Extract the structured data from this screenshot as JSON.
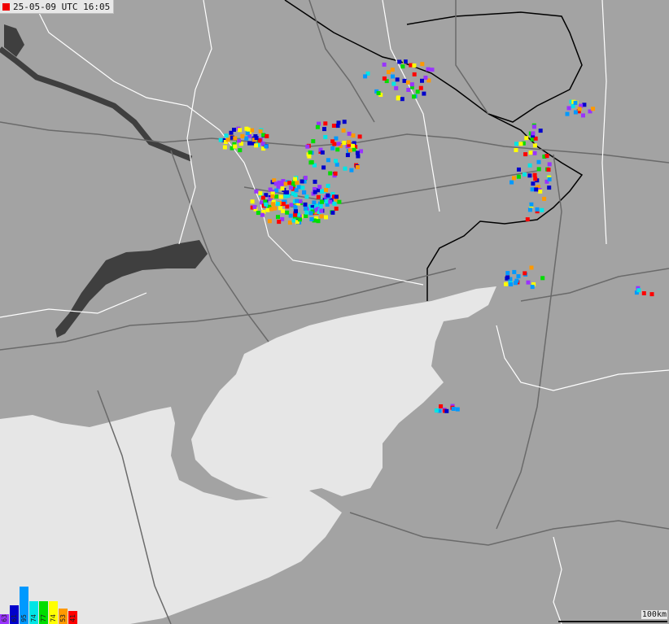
{
  "header": {
    "timestamp": "25-05-09 UTC 16:05",
    "marker_color": "#f00000"
  },
  "legend": {
    "items": [
      {
        "label": "63",
        "color": "#9933ff",
        "level": 0.25
      },
      {
        "label": "61",
        "color": "#0000cc",
        "level": 0.5
      },
      {
        "label": "95",
        "color": "#0099ff",
        "level": 1.0
      },
      {
        "label": "74",
        "color": "#00e5e5",
        "level": 0.6
      },
      {
        "label": "77",
        "color": "#00dd00",
        "level": 0.6
      },
      {
        "label": "74",
        "color": "#ffff00",
        "level": 0.6
      },
      {
        "label": "53",
        "color": "#ff9900",
        "level": 0.42
      },
      {
        "label": "41",
        "color": "#ff0000",
        "level": 0.35
      }
    ]
  },
  "scale": {
    "label": "100km"
  },
  "colors": {
    "land": "#a3a3a3",
    "sea": "#e6e6e6",
    "water": "#3f3f3f",
    "road": "#6a6a6a",
    "border": "#ffffff",
    "frontline": "#000000"
  }
}
